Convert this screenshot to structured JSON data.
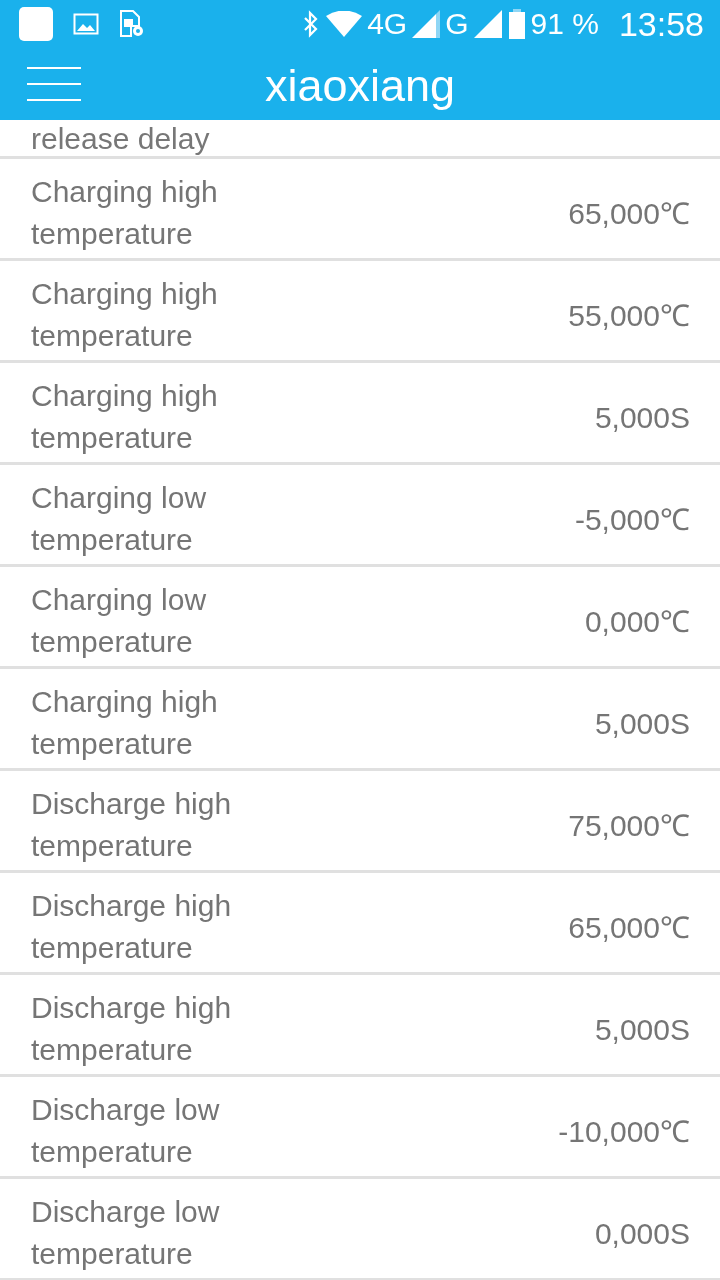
{
  "status_bar": {
    "network_1": "4G",
    "network_2": "G",
    "battery": "91 %",
    "time": "13:58"
  },
  "toolbar": {
    "title": "xiaoxiang"
  },
  "partial_row": {
    "label": "release delay"
  },
  "rows": [
    {
      "label": "Charging high temperature",
      "value": "65,000℃"
    },
    {
      "label": "Charging high temperature",
      "value": "55,000℃"
    },
    {
      "label": "Charging high temperature",
      "value": "5,000S"
    },
    {
      "label": "Charging low temperature",
      "value": "-5,000℃"
    },
    {
      "label": "Charging low temperature",
      "value": "0,000℃"
    },
    {
      "label": "Charging high temperature",
      "value": "5,000S"
    },
    {
      "label": "Discharge high temperature",
      "value": "75,000℃"
    },
    {
      "label": "Discharge high temperature",
      "value": "65,000℃"
    },
    {
      "label": "Discharge high temperature",
      "value": "5,000S"
    },
    {
      "label": "Discharge low temperature",
      "value": "-10,000℃"
    },
    {
      "label": "Discharge low temperature",
      "value": "0,000S"
    }
  ]
}
